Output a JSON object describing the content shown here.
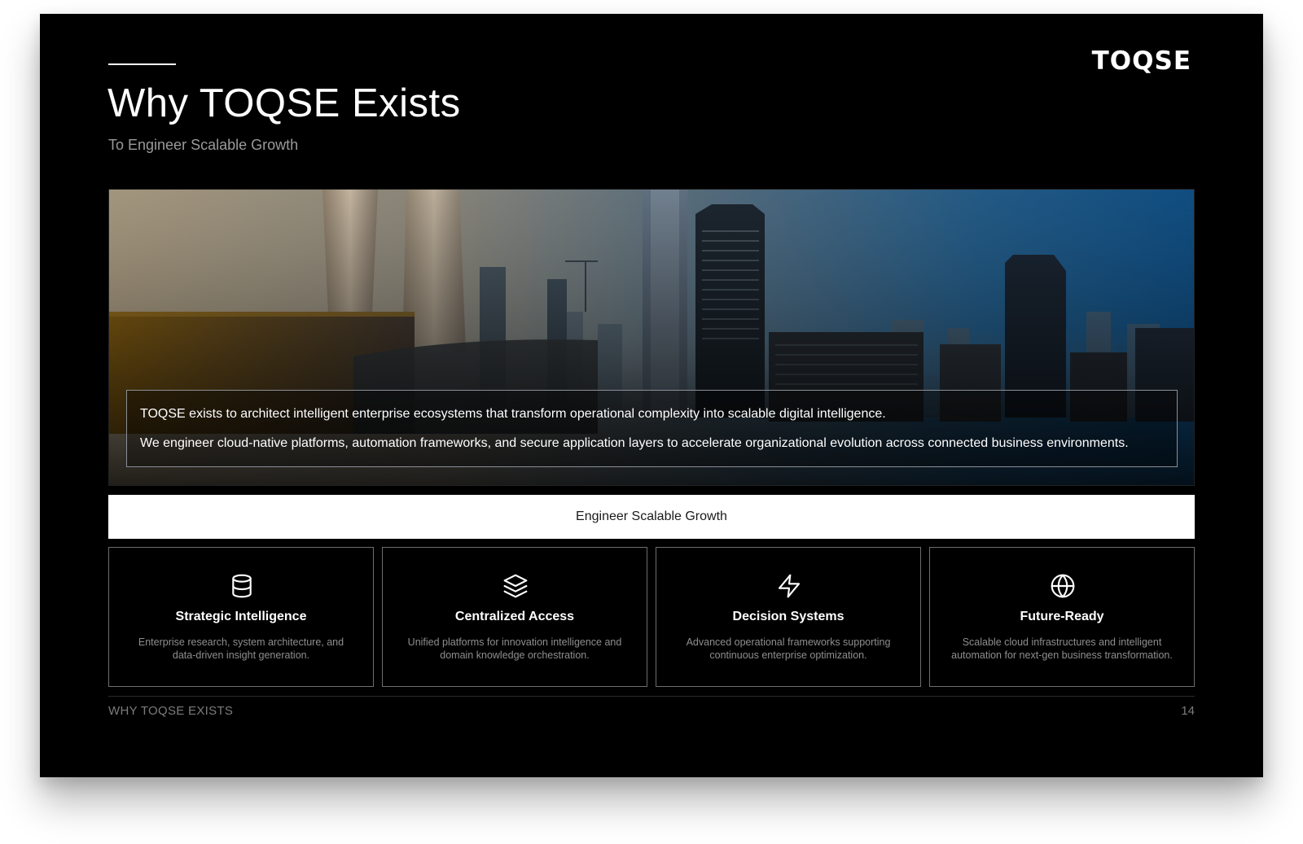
{
  "brand": {
    "logo": "TOQSE"
  },
  "header": {
    "title": "Why TOQSE Exists",
    "subtitle": "To Engineer Scalable Growth"
  },
  "hero": {
    "image": "city-skyline-photo",
    "lines": [
      "TOQSE exists to architect intelligent enterprise ecosystems that transform operational complexity into scalable digital intelligence.",
      "We engineer cloud-native platforms, automation frameworks, and secure application layers to accelerate organizational evolution across connected business environments."
    ]
  },
  "banner": {
    "label": "Engineer Scalable Growth"
  },
  "cards": [
    {
      "icon": "database-icon",
      "title": "Strategic Intelligence",
      "description": "Enterprise research, system architecture, and data-driven insight generation."
    },
    {
      "icon": "layers-icon",
      "title": "Centralized Access",
      "description": "Unified platforms for innovation intelligence and domain knowledge orchestration."
    },
    {
      "icon": "lightning-icon",
      "title": "Decision Systems",
      "description": "Advanced operational frameworks supporting continuous enterprise optimization."
    },
    {
      "icon": "globe-icon",
      "title": "Future-Ready",
      "description": "Scalable cloud infrastructures and intelligent automation for next-gen business transformation."
    }
  ],
  "footer": {
    "section": "WHY TOQSE EXISTS",
    "page_number": "14"
  },
  "colors": {
    "background": "#000000",
    "text": "#ffffff",
    "muted": "#8e8e8e",
    "banner": "#ffffff"
  }
}
